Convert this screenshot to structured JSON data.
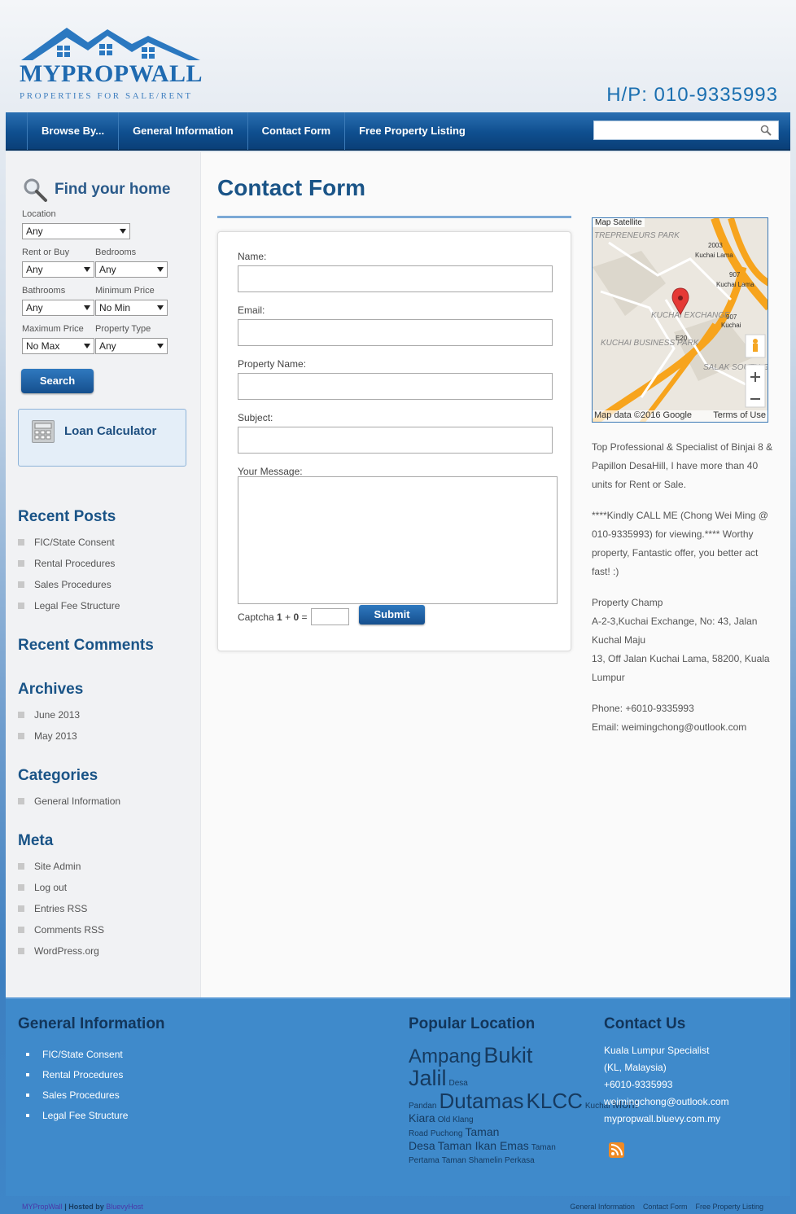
{
  "header": {
    "logo_name": "MYPROPWALL",
    "logo_tagline": "PROPERTIES FOR SALE/RENT",
    "phone": "H/P: 010-9335993"
  },
  "nav": {
    "items": [
      {
        "label": "Browse By..."
      },
      {
        "label": "General Information"
      },
      {
        "label": "Contact Form"
      },
      {
        "label": "Free Property Listing"
      }
    ],
    "search_placeholder": ""
  },
  "sidebar": {
    "find_title": "Find your home",
    "location_label": "Location",
    "location_value": "Any",
    "rent_buy_label": "Rent or Buy",
    "rent_buy_value": "Any",
    "bedrooms_label": "Bedrooms",
    "bedrooms_value": "Any",
    "bathrooms_label": "Bathrooms",
    "bathrooms_value": "Any",
    "min_price_label": "Minimum Price",
    "min_price_value": "No Min",
    "max_price_label": "Maximum Price",
    "max_price_value": "No Max",
    "property_type_label": "Property Type",
    "property_type_value": "Any",
    "search_button": "Search",
    "loan_calculator": "Loan Calculator",
    "recent_posts_title": "Recent Posts",
    "recent_posts": [
      "FIC/State Consent",
      "Rental Procedures",
      "Sales Procedures",
      "Legal Fee Structure"
    ],
    "recent_comments_title": "Recent Comments",
    "archives_title": "Archives",
    "archives": [
      "June 2013",
      "May 2013"
    ],
    "categories_title": "Categories",
    "categories": [
      "General Information"
    ],
    "meta_title": "Meta",
    "meta": [
      "Site Admin",
      "Log out",
      "Entries RSS",
      "Comments RSS",
      "WordPress.org"
    ]
  },
  "main": {
    "page_title": "Contact Form",
    "fields": {
      "name_label": "Name:",
      "email_label": "Email:",
      "property_label": "Property Name:",
      "subject_label": "Subject:",
      "message_label": "Your Message:"
    },
    "captcha_text": "Captcha",
    "captcha_a": "1",
    "captcha_op": "+",
    "captcha_b": "0",
    "captcha_eq": "=",
    "submit_label": "Submit"
  },
  "right": {
    "map_tab_map": "Map",
    "map_tab_satellite": "Satellite",
    "map_data": "Map data ©2016 Google",
    "map_terms": "Terms of Use",
    "map_labels": [
      "TREPRENEURS PARK",
      "KUCHAI EXCHANGE",
      "KUCHAI BUSINESS PARK",
      "SALAK SOUTH GARDEN",
      "Kuchai Lama",
      "Kuchai Lama",
      "Kuchai",
      "2003",
      "907",
      "907",
      "E20"
    ],
    "para1": "Top Professional & Specialist of Binjai 8 & Papillon DesaHill, I have more than 40 units for Rent or Sale.",
    "para2": "****Kindly CALL ME (Chong Wei Ming @ 010-9335993) for viewing.**** Worthy property, Fantastic offer, you better act fast! :)",
    "para3_line1": "Property Champ",
    "para3_line2": "A-2-3,Kuchai Exchange, No: 43, Jalan Kuchal Maju",
    "para3_line3": "13, Off Jalan Kuchai Lama, 58200, Kuala Lumpur",
    "phone": "Phone: +6010-9335993",
    "email": "Email: weimingchong@outlook.com"
  },
  "footer": {
    "general_title": "General Information",
    "general_items": [
      "FIC/State Consent",
      "Rental Procedures",
      "Sales Procedures",
      "Legal Fee Structure"
    ],
    "popular_title": "Popular Location",
    "tags": [
      {
        "text": "Ampang",
        "size": 24
      },
      {
        "text": "Bukit Jalil",
        "size": 27
      },
      {
        "text": "Desa Pandan",
        "size": 10
      },
      {
        "text": "Dutamas",
        "size": 26
      },
      {
        "text": "KLCC",
        "size": 26
      },
      {
        "text": "Kuchai",
        "size": 10
      },
      {
        "text": "Mont Kiara",
        "size": 14
      },
      {
        "text": "Old Klang Road",
        "size": 10
      },
      {
        "text": "Puchong",
        "size": 10
      },
      {
        "text": "Taman Desa",
        "size": 14
      },
      {
        "text": "Taman Ikan Emas",
        "size": 14
      },
      {
        "text": "Taman Pertama",
        "size": 10
      },
      {
        "text": "Taman Shamelin Perkasa",
        "size": 10
      }
    ],
    "contact_title": "Contact Us",
    "contact_lines": [
      "Kuala Lumpur Specialist",
      "(KL, Malaysia)",
      "+6010-9335993",
      "weimingchong@outlook.com",
      "mypropwall.bluevy.com.my"
    ]
  },
  "bottom": {
    "site_name": "MYPropWall",
    "hosted_text": "| Hosted by",
    "host_name": "BluevyHost",
    "links": [
      "General Information",
      "Contact Form",
      "Free Property Listing"
    ]
  }
}
